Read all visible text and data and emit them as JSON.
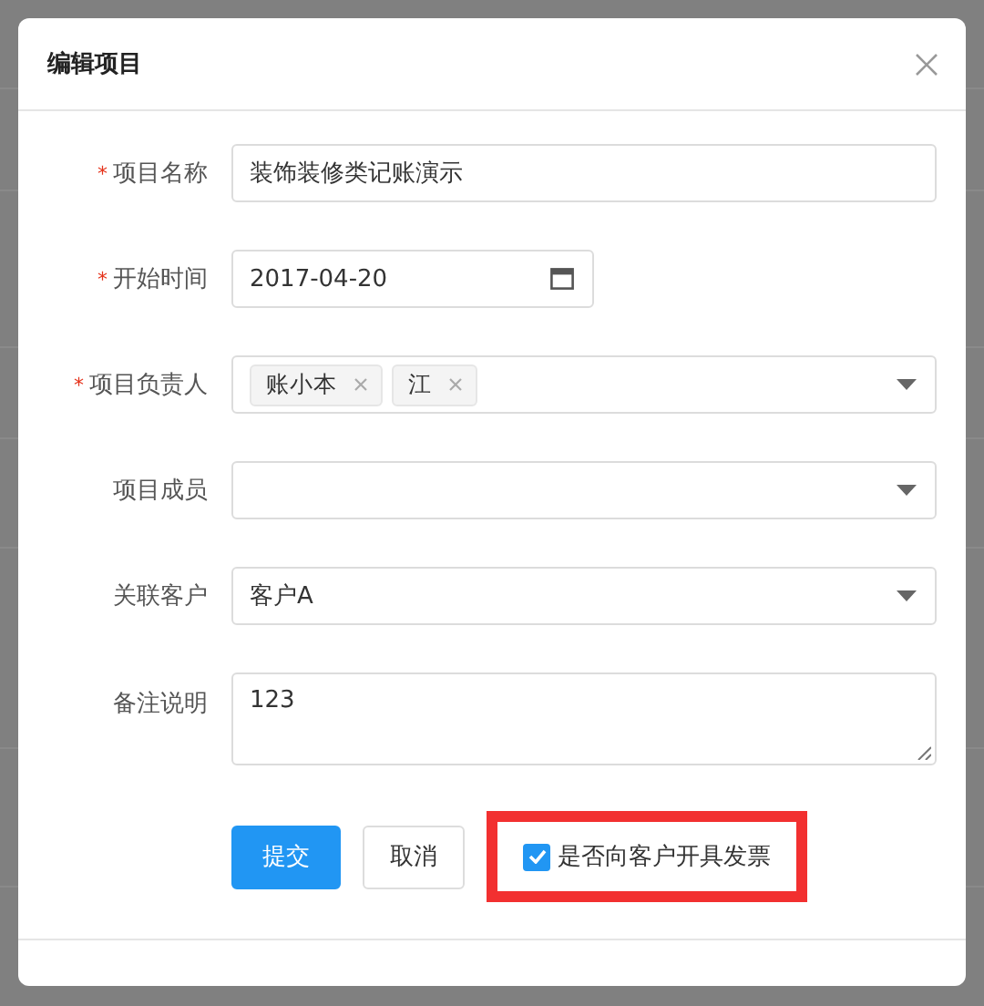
{
  "dialog": {
    "title": "编辑项目"
  },
  "fields": [
    {
      "kind": "input",
      "label": "项目名称",
      "required_mark": "*",
      "value": "装饰装修类记账演示"
    },
    {
      "kind": "date",
      "label": "开始时间",
      "required_mark": "*",
      "value": "2017-04-20"
    },
    {
      "kind": "tags",
      "label": "项目负责人",
      "required_mark": "*",
      "tags": [
        "账小本",
        "江"
      ]
    },
    {
      "kind": "select",
      "label": "项目成员"
    },
    {
      "kind": "select",
      "label": "关联客户",
      "value": "客户A"
    },
    {
      "kind": "textarea",
      "label": "备注说明",
      "value": "123"
    }
  ],
  "buttons": [
    {
      "label": "提交",
      "primary": true
    },
    {
      "label": "取消",
      "primary": false
    }
  ],
  "invoice_checkbox": {
    "label": "是否向客户开具发票",
    "checked": true
  }
}
